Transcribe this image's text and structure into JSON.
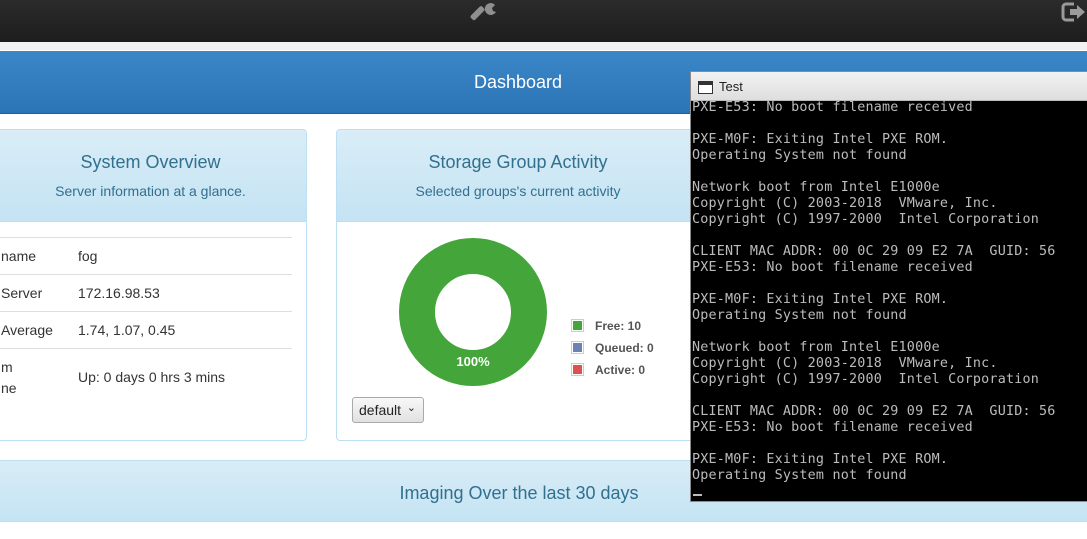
{
  "dashboard": {
    "title": "Dashboard"
  },
  "system_overview": {
    "title": "System Overview",
    "subtitle": "Server information at a glance.",
    "rows": [
      {
        "label": "name",
        "value": "fog"
      },
      {
        "label": "Server",
        "value": "172.16.98.53"
      },
      {
        "label": "Average",
        "value": "1.74, 1.07, 0.45"
      },
      {
        "label": "m",
        "label2": "ne",
        "value": "Up: 0 days 0 hrs 3 mins"
      }
    ]
  },
  "storage_group": {
    "title": "Storage Group Activity",
    "subtitle": "Selected groups's current activity",
    "select_value": "default",
    "colors": {
      "free": "#44a53a",
      "queued": "#6b82b3",
      "active": "#d9534f"
    }
  },
  "chart_data": {
    "type": "pie",
    "donut": true,
    "slices": [
      {
        "name": "Free",
        "value": 10,
        "label": "Free: 10"
      },
      {
        "name": "Queued",
        "value": 0,
        "label": "Queued: 0"
      },
      {
        "name": "Active",
        "value": 0,
        "label": "Active: 0"
      }
    ],
    "center_label": "100%",
    "legend_position": "right"
  },
  "imaging": {
    "title": "Imaging Over the last 30 days"
  },
  "terminal": {
    "title": "Test",
    "lines": [
      "PXE-E53: No boot filename received",
      "",
      "PXE-M0F: Exiting Intel PXE ROM.",
      "Operating System not found",
      "",
      "Network boot from Intel E1000e",
      "Copyright (C) 2003-2018  VMware, Inc.",
      "Copyright (C) 1997-2000  Intel Corporation",
      "",
      "CLIENT MAC ADDR: 00 0C 29 09 E2 7A  GUID: 56",
      "PXE-E53: No boot filename received",
      "",
      "PXE-M0F: Exiting Intel PXE ROM.",
      "Operating System not found",
      "",
      "Network boot from Intel E1000e",
      "Copyright (C) 2003-2018  VMware, Inc.",
      "Copyright (C) 1997-2000  Intel Corporation",
      "",
      "CLIENT MAC ADDR: 00 0C 29 09 E2 7A  GUID: 56",
      "PXE-E53: No boot filename received",
      "",
      "PXE-M0F: Exiting Intel PXE ROM.",
      "Operating System not found"
    ]
  }
}
